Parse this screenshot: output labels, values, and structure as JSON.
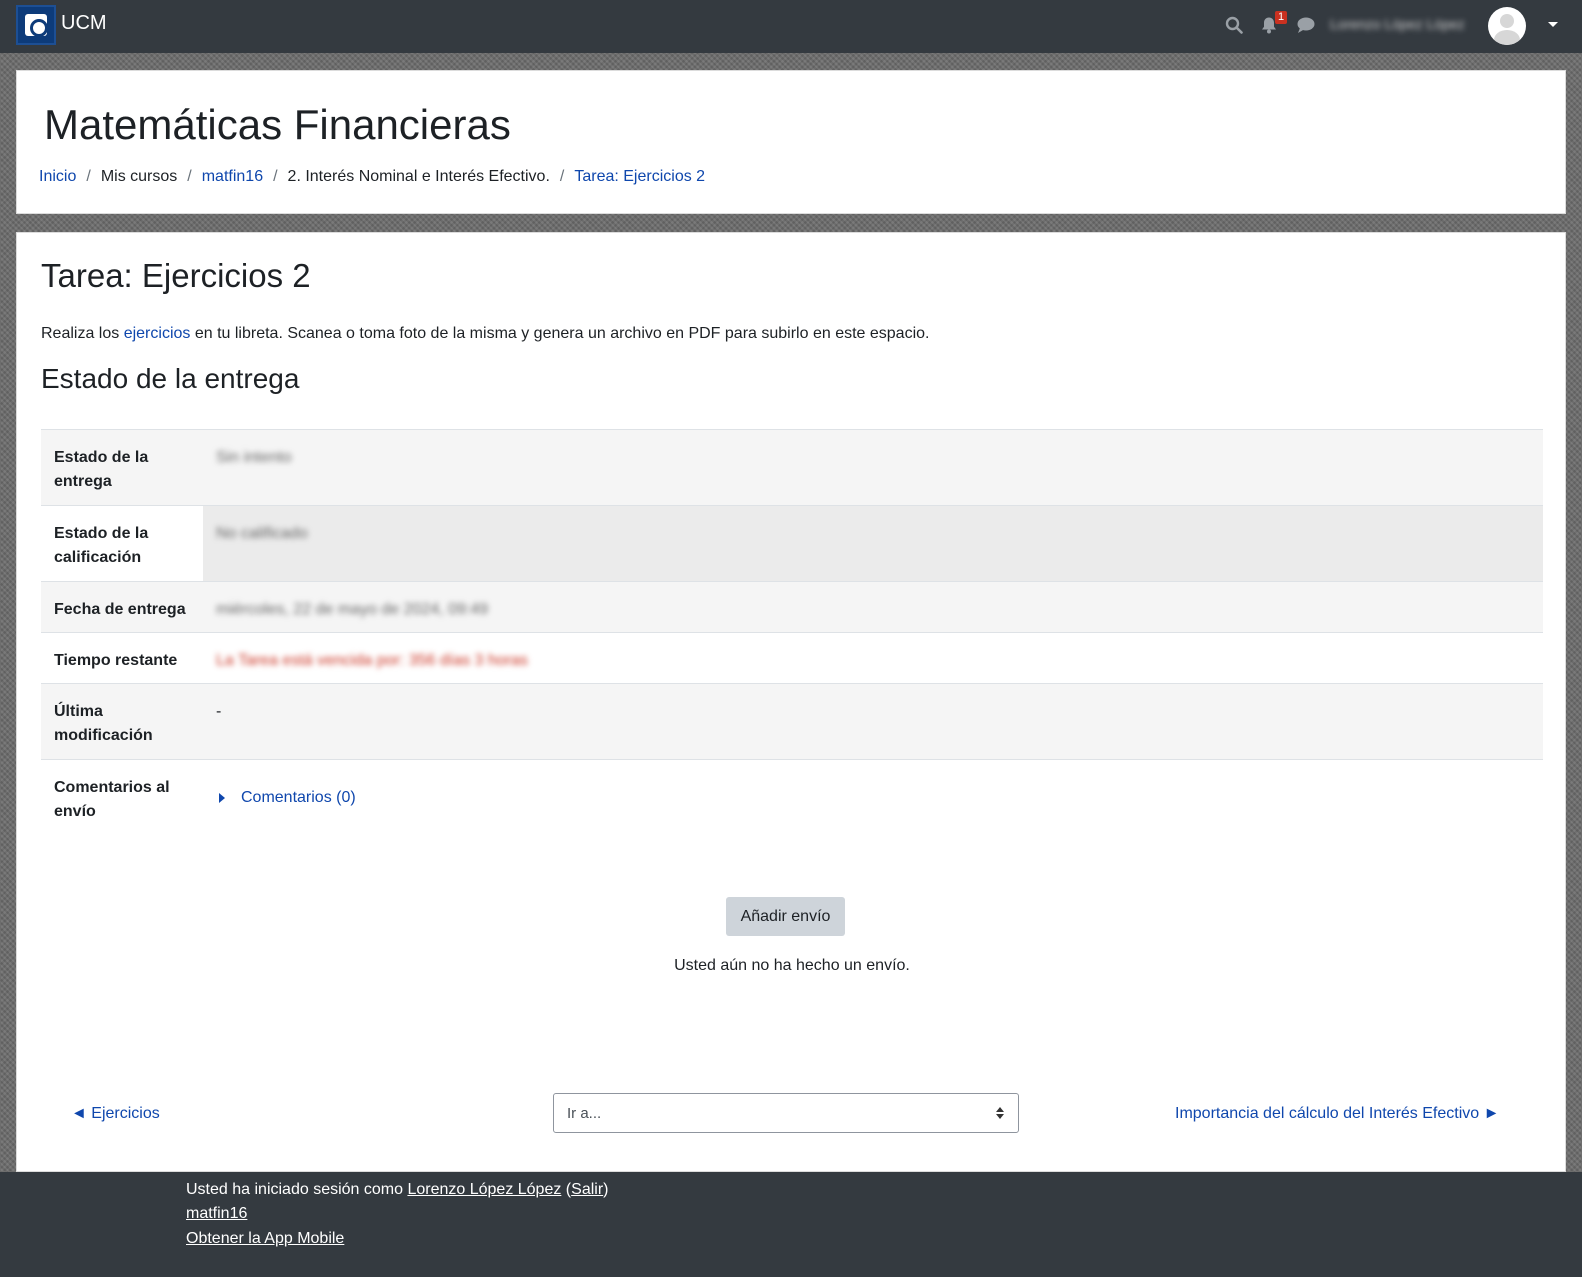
{
  "navbar": {
    "brand": "UCM",
    "notification_count": "1",
    "user_name": "Lorenzo López López"
  },
  "header": {
    "title": "Matemáticas Financieras",
    "breadcrumb": [
      "Inicio",
      "Mis cursos",
      "matfin16",
      "2. Interés Nominal e Interés Efectivo.",
      "Tarea: Ejercicios 2"
    ]
  },
  "task": {
    "title": "Tarea: Ejercicios 2",
    "intro_before": "Realiza los ",
    "intro_link": "ejercicios",
    "intro_after": " en tu libreta. Scanea o toma foto de la misma y genera un archivo en PDF para subirlo en este espacio."
  },
  "status": {
    "section_title": "Estado de la entrega",
    "rows": [
      {
        "label": "Estado de la entrega",
        "value": "Sin intento"
      },
      {
        "label": "Estado de la calificación",
        "value": "No calificado"
      },
      {
        "label": "Fecha de entrega",
        "value": "miércoles, 22 de mayo de 2024, 09:49"
      },
      {
        "label": "Tiempo restante",
        "value": "La Tarea está vencida por: 356 días 3 horas"
      },
      {
        "label": "Última modificación",
        "value": "-"
      },
      {
        "label": "Comentarios al envío",
        "value": "Comentarios (0)"
      }
    ]
  },
  "actions": {
    "submit_label": "Añadir envío",
    "no_submission": "Usted aún no ha hecho un envío."
  },
  "navigation": {
    "prev": "◄ Ejercicios",
    "jump_placeholder": "Ir a...",
    "next": "Importancia del cálculo del Interés Efectivo ►"
  },
  "footer": {
    "logged_in_prefix": "Usted ha iniciado sesión como ",
    "user_link": "Lorenzo López López",
    "logout": "Salir",
    "course_link": "matfin16",
    "app_link": "Obtener la App Mobile"
  }
}
